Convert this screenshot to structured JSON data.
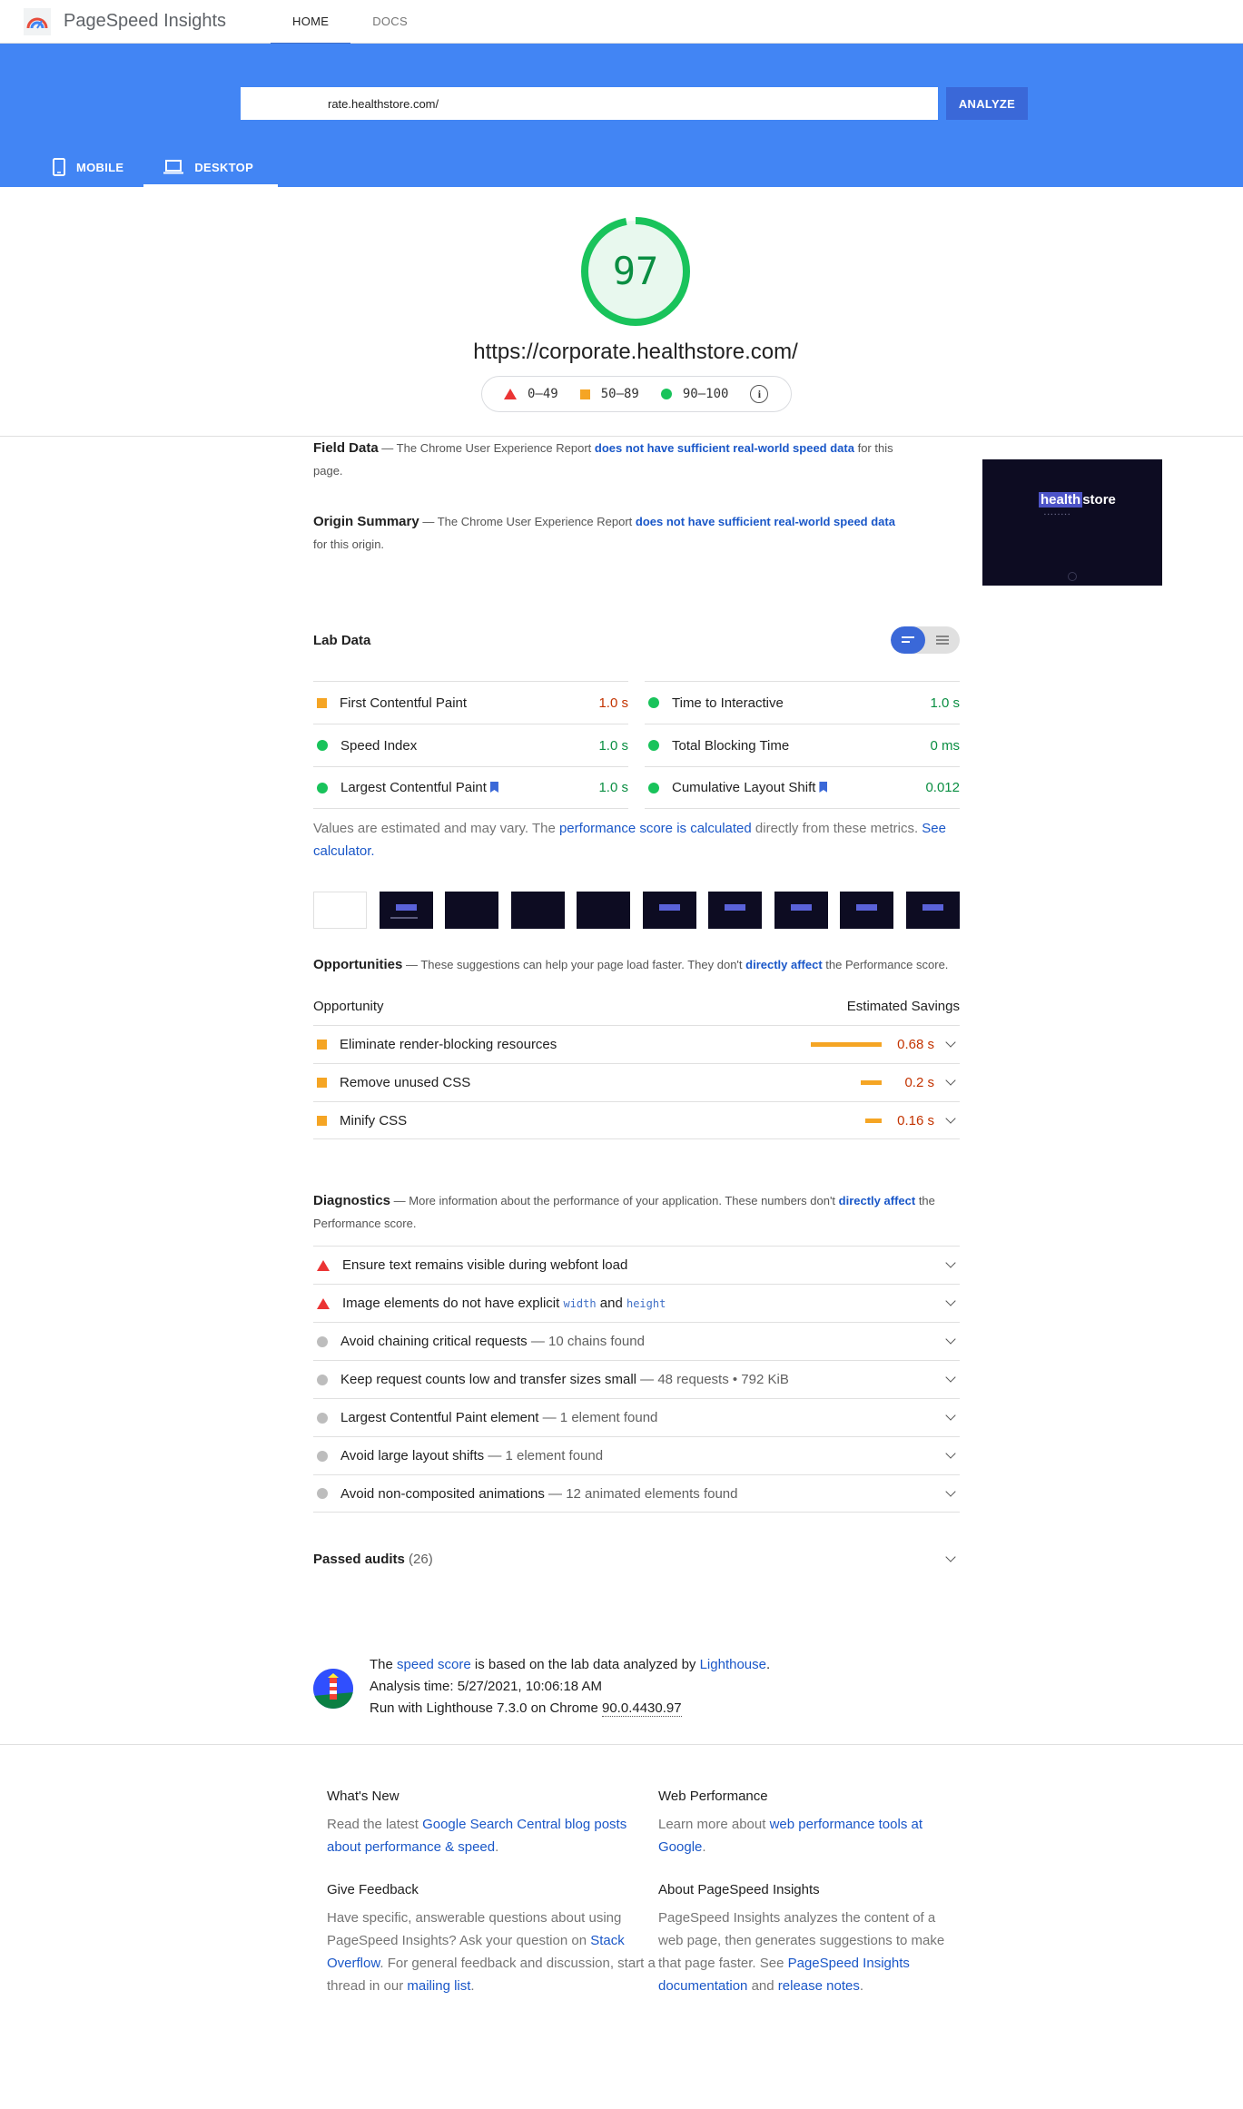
{
  "topbar": {
    "app_name": "PageSpeed Insights",
    "tabs": [
      {
        "label": "HOME"
      },
      {
        "label": "DOCS"
      }
    ]
  },
  "search": {
    "url_value": "rate.healthstore.com/",
    "analyze_label": "ANALYZE"
  },
  "device_tabs": [
    {
      "label": "MOBILE"
    },
    {
      "label": "DESKTOP"
    }
  ],
  "score": {
    "value": "97",
    "fraction": 0.97,
    "url": "https://corporate.healthstore.com/",
    "legend": {
      "fail": "0–49",
      "average": "50–89",
      "pass": "90–100"
    }
  },
  "field_data": {
    "title": "Field Data",
    "pre": " — The Chrome User Experience Report ",
    "link": "does not have sufficient real-world speed data",
    "post": " for this page."
  },
  "origin_summary": {
    "title": "Origin Summary",
    "pre": " — The Chrome User Experience Report ",
    "link": "does not have sufficient real-world speed data",
    "post": " for this origin."
  },
  "thumbnail": {
    "brand_highlight": "health",
    "brand_rest": "store"
  },
  "lab_data": {
    "title": "Lab Data",
    "metrics": [
      {
        "label": "First Contentful Paint",
        "value": "1.0 s"
      },
      {
        "label": "Time to Interactive",
        "value": "1.0 s"
      },
      {
        "label": "Speed Index",
        "value": "1.0 s"
      },
      {
        "label": "Total Blocking Time",
        "value": "0 ms"
      },
      {
        "label": "Largest Contentful Paint",
        "value": "1.0 s"
      },
      {
        "label": "Cumulative Layout Shift",
        "value": "0.012"
      }
    ],
    "note_pre": "Values are estimated and may vary. The ",
    "note_link1": "performance score is calculated",
    "note_mid": " directly from these metrics. ",
    "note_link2": "See calculator."
  },
  "opportunities": {
    "title": "Opportunities",
    "desc_pre": " — These suggestions can help your page load faster. They don't ",
    "desc_link": "directly affect",
    "desc_post": " the Performance score.",
    "col_left": "Opportunity",
    "col_right": "Estimated Savings",
    "items": [
      {
        "label": "Eliminate render-blocking resources",
        "savings": "0.68 s"
      },
      {
        "label": "Remove unused CSS",
        "savings": "0.2 s"
      },
      {
        "label": "Minify CSS",
        "savings": "0.16 s"
      }
    ]
  },
  "diagnostics": {
    "title": "Diagnostics",
    "desc_pre": " — More information about the performance of your application. These numbers don't ",
    "desc_link": "directly affect",
    "desc_post": " the Performance score.",
    "items": [
      {
        "label": "Ensure text remains visible during webfont load",
        "extra": ""
      },
      {
        "label_pre": "Image elements do not have explicit ",
        "code1": "width",
        "label_mid": " and ",
        "code2": "height"
      },
      {
        "label": "Avoid chaining critical requests",
        "extra": " — 10 chains found"
      },
      {
        "label": "Keep request counts low and transfer sizes small",
        "extra": " — 48 requests • 792 KiB"
      },
      {
        "label": "Largest Contentful Paint element",
        "extra": " — 1 element found"
      },
      {
        "label": "Avoid large layout shifts",
        "extra": " — 1 element found"
      },
      {
        "label": "Avoid non-composited animations",
        "extra": " — 12 animated elements found"
      }
    ]
  },
  "passed": {
    "title": "Passed audits",
    "count": " (26)"
  },
  "run_info": {
    "pre": "The ",
    "link1": "speed score",
    "mid": " is based on the lab data analyzed by ",
    "link2": "Lighthouse",
    "post": ".",
    "analysis_time": "Analysis time: 5/27/2021, 10:06:18 AM",
    "run_pre": "Run with Lighthouse 7.3.0 on Chrome ",
    "chrome_version": "90.0.4430.97"
  },
  "footer": {
    "whats_new": {
      "title": "What's New",
      "pre": "Read the latest ",
      "link": "Google Search Central blog posts about performance & speed",
      "post": "."
    },
    "web_perf": {
      "title": "Web Performance",
      "pre": "Learn more about ",
      "link": "web performance tools at Google",
      "post": "."
    },
    "feedback": {
      "title": "Give Feedback",
      "pre": "Have specific, answerable questions about using PageSpeed Insights? Ask your question on ",
      "link1": "Stack Overflow",
      "mid": ". For general feedback and discussion, start a thread in our ",
      "link2": "mailing list",
      "post": "."
    },
    "about": {
      "title": "About PageSpeed Insights",
      "pre": "PageSpeed Insights analyzes the content of a web page, then generates suggestions to make that page faster. See ",
      "link1": "PageSpeed Insights documentation",
      "mid": " and ",
      "link2": "release notes",
      "post": "."
    }
  },
  "colors": {
    "brand_blue": "#4285f4",
    "pass": "#19c35b",
    "average": "#f5a524",
    "fail": "#eb3434",
    "link": "#1a57c8"
  },
  "icons": [
    "psi-logo-icon",
    "phone-icon",
    "laptop-icon",
    "info-icon",
    "bookmark-flag-icon",
    "chevron-down-icon",
    "lighthouse-icon"
  ]
}
